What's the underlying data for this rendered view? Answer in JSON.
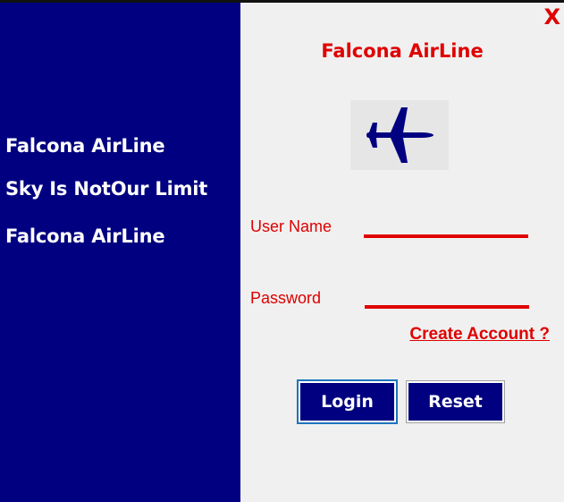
{
  "window": {
    "close_label": "X"
  },
  "left_panel": {
    "line1": "Falcona AirLine",
    "line2": "Sky Is NotOur Limit",
    "line3": "Falcona AirLine"
  },
  "login_form": {
    "title": "Falcona AirLine",
    "logo_icon": "airplane-icon",
    "username_label": "User Name",
    "username_value": "",
    "password_label": "Password",
    "password_value": "",
    "create_account_link": "Create Account ?",
    "login_button": "Login",
    "reset_button": "Reset"
  },
  "colors": {
    "navy": "#000080",
    "red": "#e00000",
    "panel_bg": "#f0f0f0",
    "logo_bg": "#e6e6e6"
  }
}
